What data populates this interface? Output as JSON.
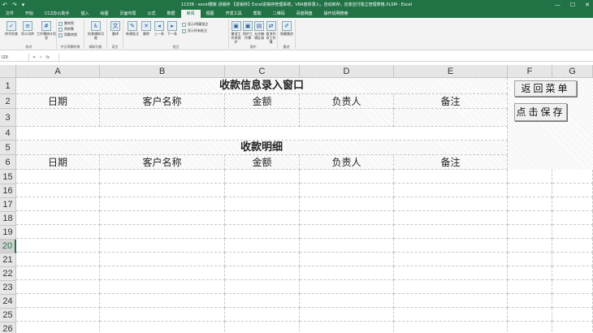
{
  "app": {
    "quick_access": [
      "↶",
      "↷",
      "▾"
    ],
    "window_title": "11338 - excel模板 进销存 【进销存】Excel进销存管理系统，VBA窗体录入，自动库存，应收应付独立管理表格.XLSM - Excel",
    "window_buttons": [
      "—",
      "☐",
      "✕"
    ]
  },
  "menu": {
    "tabs": [
      "文件",
      "开始",
      "CCZ办公助手",
      "插入",
      "绘图",
      "页面布局",
      "公式",
      "数据",
      "审阅",
      "视图",
      "开发工具",
      "帮助",
      "二维码",
      "百度网盘",
      "操作说明搜索"
    ],
    "active_index": 8
  },
  "ribbon": {
    "groups": [
      {
        "name": "校对",
        "buttons": [
          "拼写检查",
          "同义词库",
          "工作簿统计信息"
        ]
      },
      {
        "name": "中文简繁转换",
        "buttons": [
          "繁转简",
          "简转繁",
          "简繁转换"
        ]
      },
      {
        "name": "辅助功能",
        "buttons": [
          "检查辅助功能"
        ]
      },
      {
        "name": "语言",
        "buttons": [
          "翻译"
        ]
      },
      {
        "name": "批注",
        "buttons": [
          "新建批注",
          "删除",
          "上一条",
          "下一条",
          "显示/隐藏批注",
          "显示所有批注"
        ]
      },
      {
        "name": "保护",
        "buttons": [
          "撤消工作表保护",
          "保护工作簿",
          "允许编辑区域",
          "取消共享工作簿"
        ]
      },
      {
        "name": "墨迹",
        "buttons": [
          "隐藏墨迹"
        ]
      }
    ]
  },
  "formula_bar": {
    "name_box": "I20",
    "fx_label": "fx",
    "controls": [
      "✕",
      "✓"
    ],
    "formula": ""
  },
  "columns": [
    "A",
    "B",
    "C",
    "D",
    "E",
    "F",
    "G"
  ],
  "rows": [
    "1",
    "2",
    "3",
    "4",
    "5",
    "6",
    "15",
    "16",
    "17",
    "18",
    "19",
    "20",
    "21",
    "22",
    "23",
    "24",
    "25",
    "26"
  ],
  "selected_row": "20",
  "sheet": {
    "entry_title": "收款信息录入窗口",
    "entry_headers": [
      "日期",
      "客户名称",
      "金额",
      "负责人",
      "备注"
    ],
    "detail_title": "收款明细",
    "detail_headers": [
      "日期",
      "客户名称",
      "金额",
      "负责人",
      "备注"
    ]
  },
  "buttons": {
    "back_menu": "返回菜单",
    "save": "点击保存"
  }
}
